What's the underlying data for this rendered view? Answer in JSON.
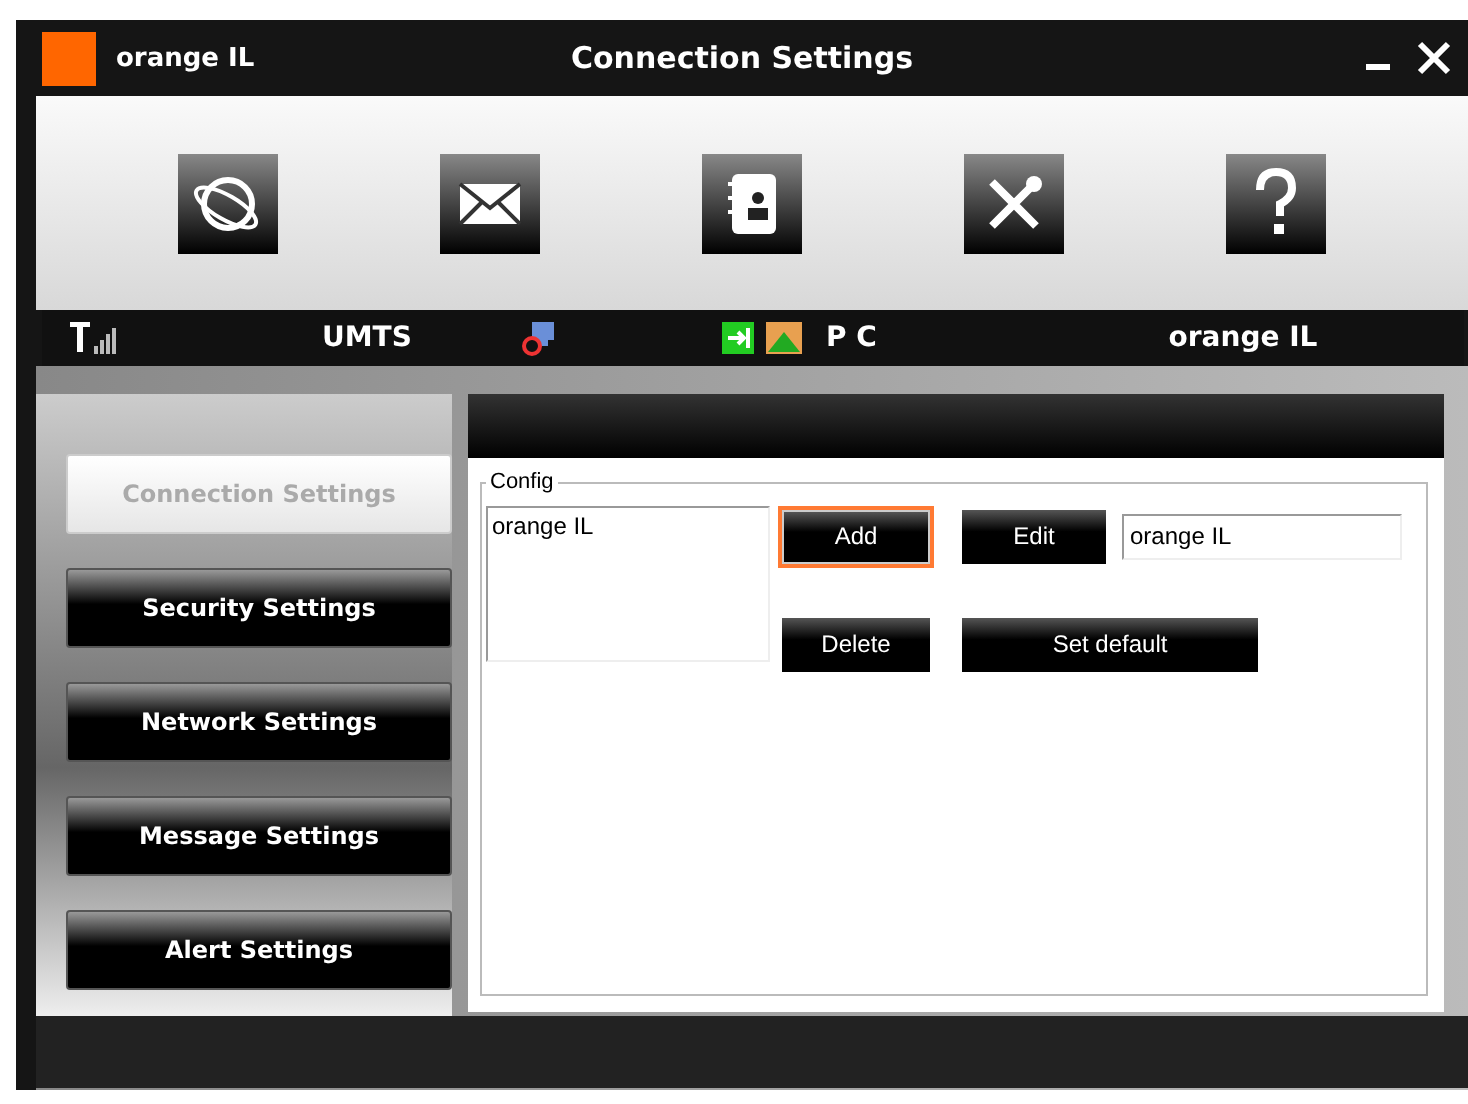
{
  "window": {
    "title": "Connection Settings",
    "brand": "orange IL"
  },
  "status_bar": {
    "network": "UMTS",
    "mode": "P C",
    "operator": "orange IL"
  },
  "sidebar": {
    "items": [
      {
        "label": "Connection Settings",
        "selected": true
      },
      {
        "label": "Security Settings",
        "selected": false
      },
      {
        "label": "Network Settings",
        "selected": false
      },
      {
        "label": "Message Settings",
        "selected": false
      },
      {
        "label": "Alert Settings",
        "selected": false
      }
    ]
  },
  "config": {
    "legend": "Config",
    "profiles": [
      "orange IL"
    ],
    "name_value": "orange IL",
    "buttons": [
      {
        "label": "Add",
        "focused": true
      },
      {
        "label": "Edit",
        "focused": false
      },
      {
        "label": "Delete",
        "focused": false
      },
      {
        "label": "Set default",
        "focused": false
      }
    ]
  }
}
